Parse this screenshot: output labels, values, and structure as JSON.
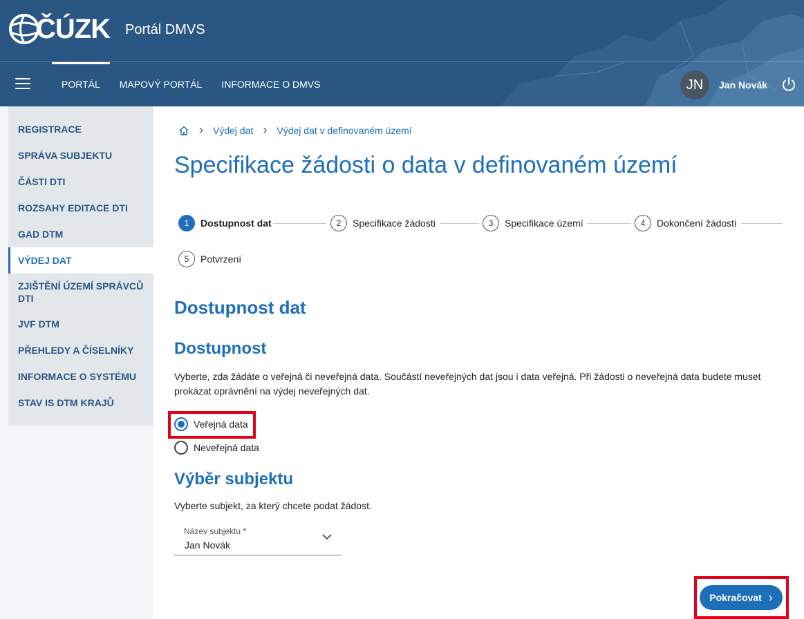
{
  "header": {
    "logo_text": "ČÚZK",
    "app_title": "Portál DMVS",
    "nav": [
      {
        "label": "Portál",
        "active": true
      },
      {
        "label": "Mapový portál",
        "active": false
      },
      {
        "label": "Informace o DMVS",
        "active": false
      }
    ],
    "user": {
      "initials": "JN",
      "name": "Jan Novák"
    }
  },
  "sidebar": {
    "items": [
      {
        "label": "Registrace"
      },
      {
        "label": "Správa subjektu"
      },
      {
        "label": "Části DTI"
      },
      {
        "label": "Rozsahy editace DTI"
      },
      {
        "label": "GAD DTM"
      },
      {
        "label": "Výdej dat",
        "active": true
      },
      {
        "label": "Zjištění území správců DTI"
      },
      {
        "label": "JVF DTM"
      },
      {
        "label": "Přehledy a číselníky"
      },
      {
        "label": "Informace o systému"
      },
      {
        "label": "Stav IS DTM krajů"
      }
    ]
  },
  "breadcrumb": [
    "Výdej dat",
    "Výdej dat v definovaném území"
  ],
  "page_title": "Specifikace žádosti o data v definovaném území",
  "stepper": [
    {
      "num": "1",
      "label": "Dostupnost dat",
      "active": true
    },
    {
      "num": "2",
      "label": "Specifikace žádosti"
    },
    {
      "num": "3",
      "label": "Specifikace území"
    },
    {
      "num": "4",
      "label": "Dokončení žádosti"
    },
    {
      "num": "5",
      "label": "Potvrzení"
    }
  ],
  "section_title": "Dostupnost dat",
  "availability": {
    "title": "Dostupnost",
    "description": "Vyberte, zda žádáte o veřejná či neveřejná data. Součástí neveřejných dat jsou i data veřejná. Při žádosti o neveřejná data budete muset prokázat oprávnění na výdej neveřejných dat.",
    "options": [
      {
        "label": "Veřejná data",
        "checked": true
      },
      {
        "label": "Neveřejná data",
        "checked": false
      }
    ]
  },
  "subject": {
    "title": "Výběr subjektu",
    "description": "Vyberte subjekt, za který chcete podat žádost.",
    "field_label": "Název subjektu *",
    "field_value": "Jan Novák"
  },
  "continue_label": "Pokračovat",
  "colors": {
    "header": "#2a5683",
    "accent": "#1e6fb9",
    "highlight": "#e2001a"
  }
}
